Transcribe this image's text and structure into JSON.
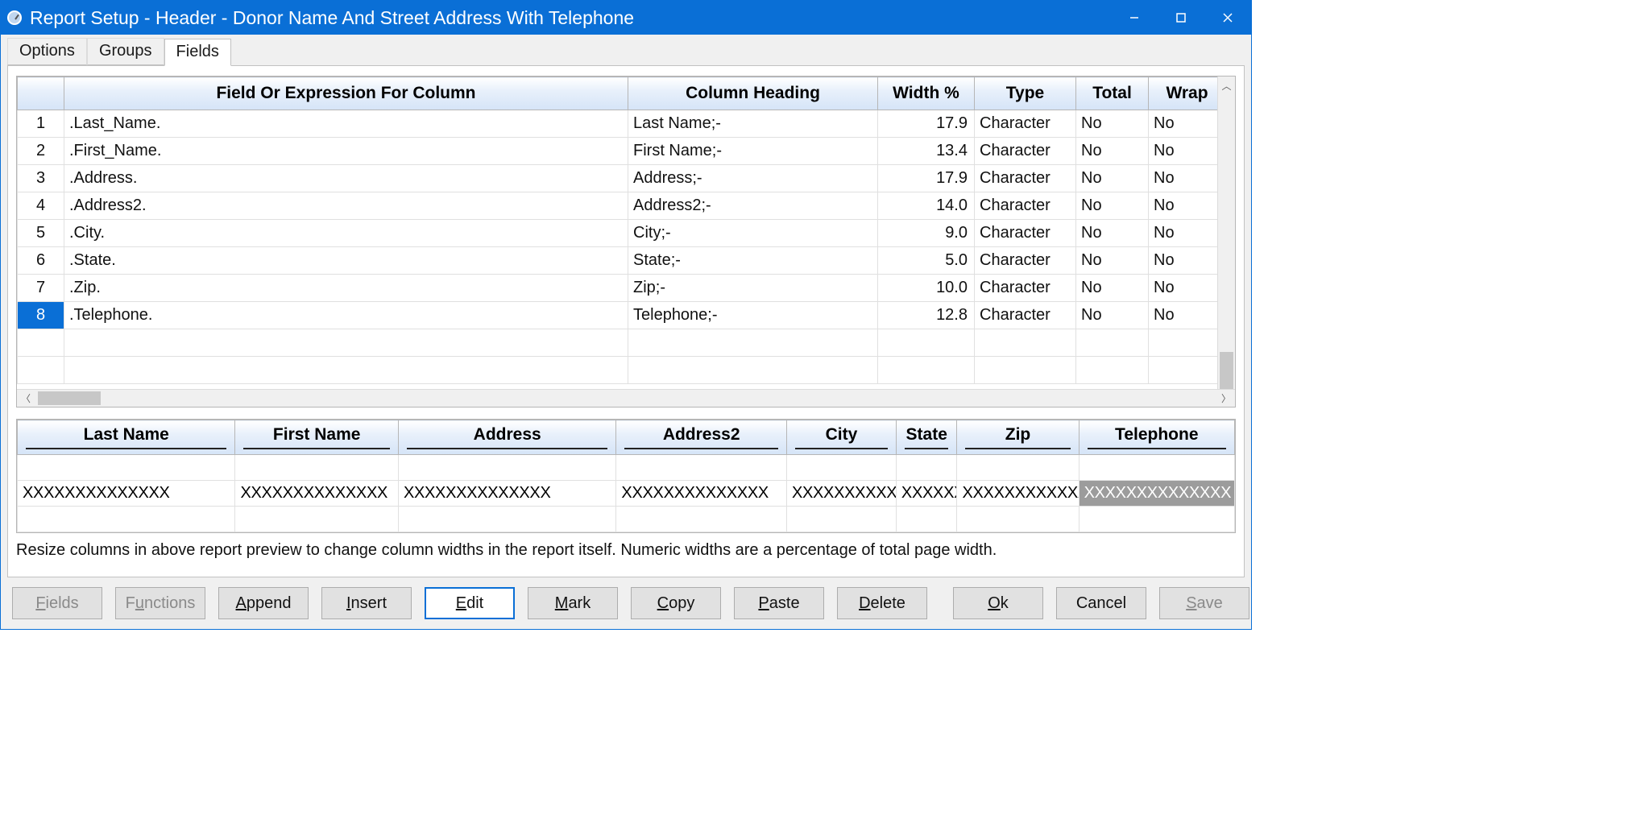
{
  "window": {
    "title": "Report Setup - Header - Donor Name And Street Address With Telephone"
  },
  "tabs": {
    "options": "Options",
    "groups": "Groups",
    "fields": "Fields",
    "active": "fields"
  },
  "grid": {
    "headers": {
      "rownum": "",
      "field": "Field Or Expression For Column",
      "heading": "Column Heading",
      "width": "Width %",
      "type": "Type",
      "total": "Total",
      "wrap": "Wrap"
    },
    "rows": [
      {
        "n": "1",
        "field": ".Last_Name.",
        "heading": "Last Name;-",
        "width": "17.9",
        "type": "Character",
        "total": "No",
        "wrap": "No"
      },
      {
        "n": "2",
        "field": ".First_Name.",
        "heading": "First Name;-",
        "width": "13.4",
        "type": "Character",
        "total": "No",
        "wrap": "No"
      },
      {
        "n": "3",
        "field": ".Address.",
        "heading": "Address;-",
        "width": "17.9",
        "type": "Character",
        "total": "No",
        "wrap": "No"
      },
      {
        "n": "4",
        "field": ".Address2.",
        "heading": "Address2;-",
        "width": "14.0",
        "type": "Character",
        "total": "No",
        "wrap": "No"
      },
      {
        "n": "5",
        "field": ".City.",
        "heading": "City;-",
        "width": "9.0",
        "type": "Character",
        "total": "No",
        "wrap": "No"
      },
      {
        "n": "6",
        "field": ".State.",
        "heading": "State;-",
        "width": "5.0",
        "type": "Character",
        "total": "No",
        "wrap": "No"
      },
      {
        "n": "7",
        "field": ".Zip.",
        "heading": "Zip;-",
        "width": "10.0",
        "type": "Character",
        "total": "No",
        "wrap": "No"
      },
      {
        "n": "8",
        "field": ".Telephone.",
        "heading": "Telephone;-",
        "width": "12.8",
        "type": "Character",
        "total": "No",
        "wrap": "No"
      }
    ],
    "selected_row": 8
  },
  "preview": {
    "headers": [
      "Last Name",
      "First Name",
      "Address",
      "Address2",
      "City",
      "State",
      "Zip",
      "Telephone"
    ],
    "row": [
      "XXXXXXXXXXXXXX",
      "XXXXXXXXXXXXXX",
      "XXXXXXXXXXXXXX",
      "XXXXXXXXXXXXXX",
      "XXXXXXXXXXXX",
      "XXXXXX",
      "XXXXXXXXXXXXXXX",
      "XXXXXXXXXXXXXX"
    ],
    "selected_col": 7
  },
  "hint": "Resize columns in above report preview to change column widths in the report itself. Numeric widths are a percentage of total page width.",
  "buttons": [
    {
      "key": "fields",
      "label": "Fields",
      "mnemonic": "F",
      "disabled": true
    },
    {
      "key": "functions",
      "label": "Functions",
      "mnemonic": "u",
      "disabled": true
    },
    {
      "key": "append",
      "label": "Append",
      "mnemonic": "A"
    },
    {
      "key": "insert",
      "label": "Insert",
      "mnemonic": "I"
    },
    {
      "key": "edit",
      "label": "Edit",
      "mnemonic": "E",
      "focused": true
    },
    {
      "key": "mark",
      "label": "Mark",
      "mnemonic": "M"
    },
    {
      "key": "copy",
      "label": "Copy",
      "mnemonic": "C"
    },
    {
      "key": "paste",
      "label": "Paste",
      "mnemonic": "P"
    },
    {
      "key": "delete",
      "label": "Delete",
      "mnemonic": "D"
    }
  ],
  "buttons_right": [
    {
      "key": "ok",
      "label": "Ok",
      "mnemonic": "O"
    },
    {
      "key": "cancel",
      "label": "Cancel"
    },
    {
      "key": "save",
      "label": "Save",
      "mnemonic": "S",
      "disabled": true
    }
  ]
}
